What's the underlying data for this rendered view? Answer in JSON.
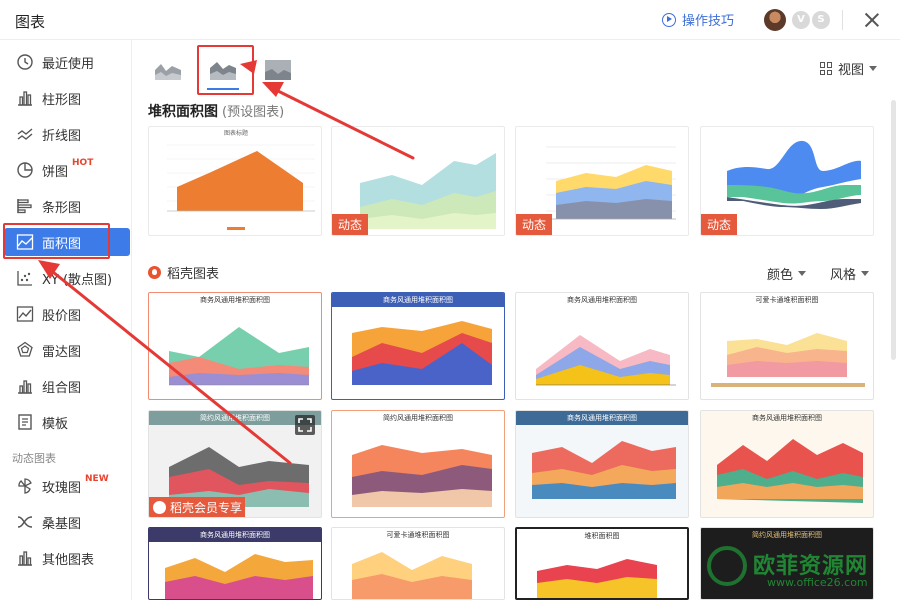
{
  "window": {
    "title": "图表"
  },
  "header": {
    "tips_label": "操作技巧",
    "badge1": "V",
    "badge2": "S"
  },
  "sidebar": {
    "items": [
      {
        "label": "最近使用",
        "icon": "clock-icon"
      },
      {
        "label": "柱形图",
        "icon": "bar-chart-icon"
      },
      {
        "label": "折线图",
        "icon": "line-chart-icon"
      },
      {
        "label": "饼图",
        "icon": "pie-chart-icon",
        "badge": "HOT"
      },
      {
        "label": "条形图",
        "icon": "horizontal-bar-icon"
      },
      {
        "label": "面积图",
        "icon": "area-chart-icon",
        "active": true
      },
      {
        "label": "XY (散点图)",
        "icon": "scatter-icon"
      },
      {
        "label": "股价图",
        "icon": "stock-chart-icon"
      },
      {
        "label": "雷达图",
        "icon": "radar-chart-icon"
      },
      {
        "label": "组合图",
        "icon": "combo-chart-icon"
      },
      {
        "label": "模板",
        "icon": "template-icon"
      }
    ],
    "dynamic_group": "动态图表",
    "dynamic_items": [
      {
        "label": "玫瑰图",
        "icon": "rose-chart-icon",
        "badge": "NEW"
      },
      {
        "label": "桑基图",
        "icon": "sankey-icon"
      },
      {
        "label": "其他图表",
        "icon": "other-chart-icon"
      }
    ]
  },
  "main": {
    "view_label": "视图",
    "section_title": "堆积面积图",
    "section_subtitle": "(预设图表)",
    "dynamic_tag": "动态",
    "preset_chart_title": "图表标题",
    "daoke_title": "稻壳图表",
    "color_label": "颜色",
    "style_label": "风格",
    "member_tag": "稻壳会员专享",
    "templates": [
      "商务风通用堆积面积图",
      "商务风通用堆积面积图",
      "商务风通用堆积面积图",
      "可爱卡通堆积面积图",
      "简约风通用堆积面积图",
      "简约风通用堆积面积图",
      "商务风通用堆积面积图",
      "商务风通用堆积面积图",
      "商务风通用堆积面积图",
      "可爱卡通堆积面积图",
      "堆积面积图",
      "简约风通用堆积面积图"
    ]
  },
  "watermark": {
    "text": "欧菲资源网",
    "url": "www.office26.com"
  },
  "colors": {
    "accent": "#3d7ce8",
    "highlight": "#e53935",
    "tag": "#e55a3c"
  }
}
